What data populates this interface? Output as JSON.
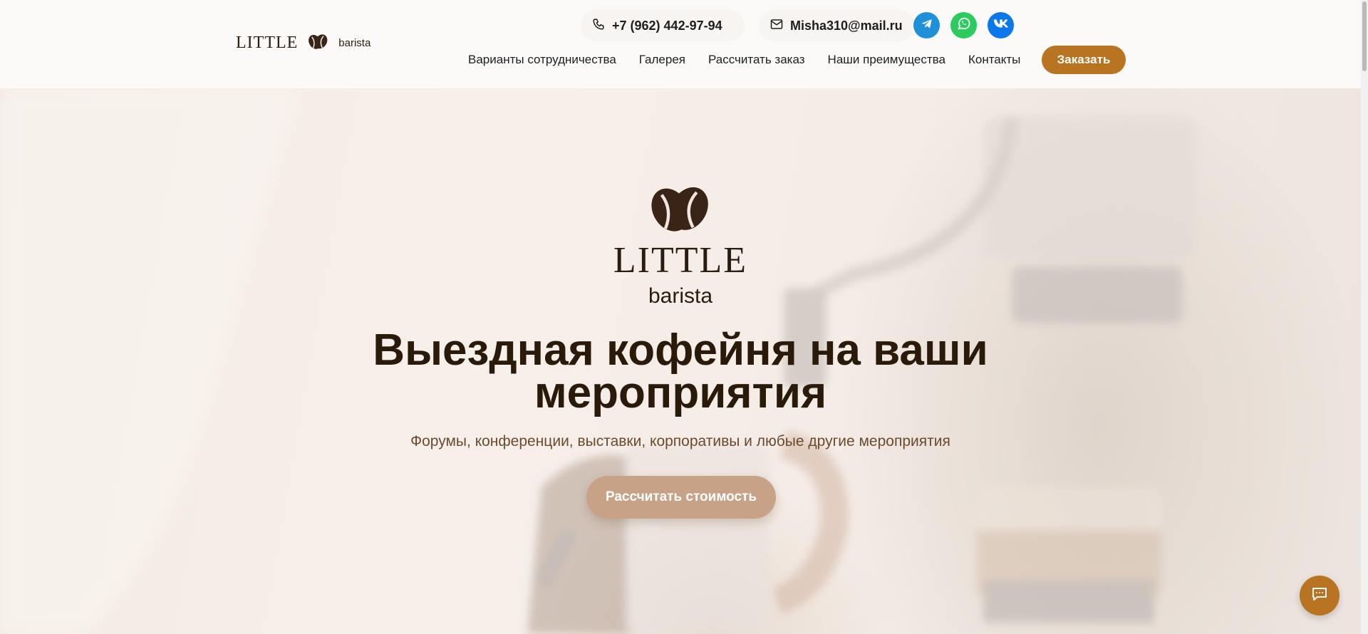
{
  "header": {
    "logo": {
      "word": "LITTLE",
      "sub": "barista",
      "icon": "coffee-bean-icon"
    },
    "phone": {
      "icon": "phone-icon",
      "text": "+7 (962) 442-97-94"
    },
    "email": {
      "icon": "mail-icon",
      "text": "Misha310@mail.ru"
    },
    "socials": [
      {
        "name": "telegram",
        "icon": "telegram-icon",
        "color": "#1e8fd8"
      },
      {
        "name": "whatsapp",
        "icon": "whatsapp-icon",
        "color": "#2ccb5d"
      },
      {
        "name": "vk",
        "icon": "vk-icon",
        "color": "#0c77ea"
      }
    ],
    "nav": [
      "Варианты сотрудничества",
      "Галерея",
      "Рассчитать заказ",
      "Наши преимущества",
      "Контакты"
    ],
    "order_button": "Заказать"
  },
  "hero": {
    "logo": {
      "word": "LITTLE",
      "sub": "barista",
      "icon": "coffee-bean-icon"
    },
    "title": "Выездная кофейня на ваши мероприятия",
    "subtitle": "Форумы, конференции, выставки, корпоративы и любые другие мероприятия",
    "cta_button": "Рассчитать стоимость"
  },
  "chat_widget": {
    "icon": "chat-icon"
  },
  "colors": {
    "accent": "#b87420",
    "cta": "#c8a287",
    "title": "#2a1a0a",
    "subtitle": "#6b4a2d"
  }
}
